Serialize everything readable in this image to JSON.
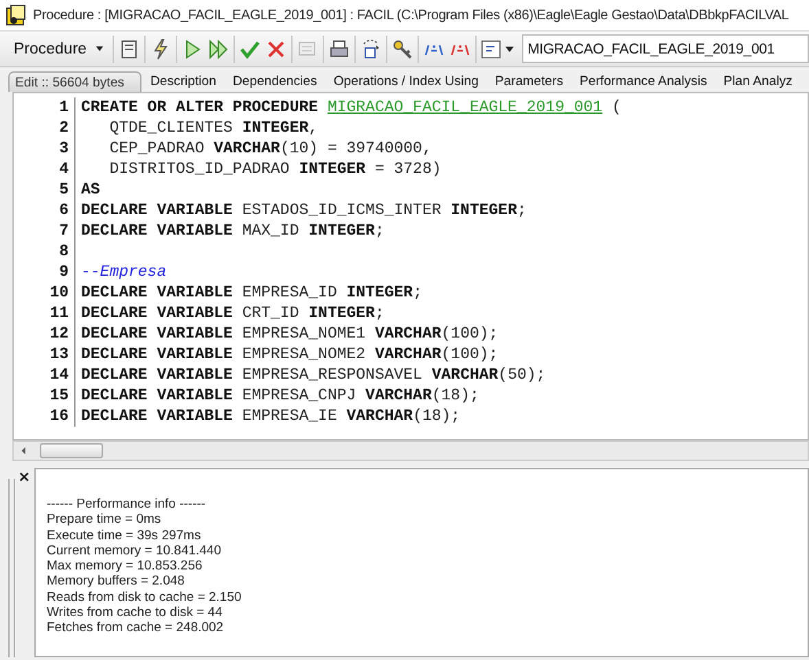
{
  "window": {
    "title": "Procedure : [MIGRACAO_FACIL_EAGLE_2019_001] : FACIL (C:\\Program Files (x86)\\Eagle\\Eagle Gestao\\Data\\DBbkpFACILVAL"
  },
  "toolbar": {
    "object_type": "Procedure",
    "object_name": "MIGRACAO_FACIL_EAGLE_2019_001"
  },
  "tabs": [
    {
      "label": "Edit :: 56604 bytes",
      "selected": true
    },
    {
      "label": "Description",
      "selected": false
    },
    {
      "label": "Dependencies",
      "selected": false
    },
    {
      "label": "Operations / Index Using",
      "selected": false
    },
    {
      "label": "Parameters",
      "selected": false
    },
    {
      "label": "Performance Analysis",
      "selected": false
    },
    {
      "label": "Plan Analyz",
      "selected": false
    }
  ],
  "editor": {
    "lines": [
      {
        "number": "1",
        "segments": [
          {
            "kind": "keyword",
            "text": "CREATE OR ALTER PROCEDURE "
          },
          {
            "kind": "name",
            "text": "MIGRACAO_FACIL_EAGLE_2019_001"
          },
          {
            "kind": "plain",
            "text": " ("
          }
        ]
      },
      {
        "number": "2",
        "segments": [
          {
            "kind": "plain",
            "text": "   QTDE_CLIENTES "
          },
          {
            "kind": "keyword",
            "text": "INTEGER"
          },
          {
            "kind": "plain",
            "text": ","
          }
        ]
      },
      {
        "number": "3",
        "segments": [
          {
            "kind": "plain",
            "text": "   CEP_PADRAO "
          },
          {
            "kind": "keyword",
            "text": "VARCHAR"
          },
          {
            "kind": "plain",
            "text": "(10) = 39740000,"
          }
        ]
      },
      {
        "number": "4",
        "segments": [
          {
            "kind": "plain",
            "text": "   DISTRITOS_ID_PADRAO "
          },
          {
            "kind": "keyword",
            "text": "INTEGER"
          },
          {
            "kind": "plain",
            "text": " = 3728)"
          }
        ]
      },
      {
        "number": "5",
        "segments": [
          {
            "kind": "keyword",
            "text": "AS"
          }
        ]
      },
      {
        "number": "6",
        "segments": [
          {
            "kind": "keyword",
            "text": "DECLARE VARIABLE "
          },
          {
            "kind": "plain",
            "text": "ESTADOS_ID_ICMS_INTER "
          },
          {
            "kind": "keyword",
            "text": "INTEGER"
          },
          {
            "kind": "plain",
            "text": ";"
          }
        ]
      },
      {
        "number": "7",
        "segments": [
          {
            "kind": "keyword",
            "text": "DECLARE VARIABLE "
          },
          {
            "kind": "plain",
            "text": "MAX_ID "
          },
          {
            "kind": "keyword",
            "text": "INTEGER"
          },
          {
            "kind": "plain",
            "text": ";"
          }
        ]
      },
      {
        "number": "8"
      },
      {
        "number": "9",
        "segments": [
          {
            "kind": "comment",
            "text": "--Empresa"
          }
        ]
      },
      {
        "number": "10",
        "segments": [
          {
            "kind": "keyword",
            "text": "DECLARE VARIABLE "
          },
          {
            "kind": "plain",
            "text": "EMPRESA_ID "
          },
          {
            "kind": "keyword",
            "text": "INTEGER"
          },
          {
            "kind": "plain",
            "text": ";"
          }
        ]
      },
      {
        "number": "11",
        "segments": [
          {
            "kind": "keyword",
            "text": "DECLARE VARIABLE "
          },
          {
            "kind": "plain",
            "text": "CRT_ID "
          },
          {
            "kind": "keyword",
            "text": "INTEGER"
          },
          {
            "kind": "plain",
            "text": ";"
          }
        ]
      },
      {
        "number": "12",
        "segments": [
          {
            "kind": "keyword",
            "text": "DECLARE VARIABLE "
          },
          {
            "kind": "plain",
            "text": "EMPRESA_NOME1 "
          },
          {
            "kind": "keyword",
            "text": "VARCHAR"
          },
          {
            "kind": "plain",
            "text": "(100);"
          }
        ]
      },
      {
        "number": "13",
        "segments": [
          {
            "kind": "keyword",
            "text": "DECLARE VARIABLE "
          },
          {
            "kind": "plain",
            "text": "EMPRESA_NOME2 "
          },
          {
            "kind": "keyword",
            "text": "VARCHAR"
          },
          {
            "kind": "plain",
            "text": "(100);"
          }
        ]
      },
      {
        "number": "14",
        "segments": [
          {
            "kind": "keyword",
            "text": "DECLARE VARIABLE "
          },
          {
            "kind": "plain",
            "text": "EMPRESA_RESPONSAVEL "
          },
          {
            "kind": "keyword",
            "text": "VARCHAR"
          },
          {
            "kind": "plain",
            "text": "(50);"
          }
        ]
      },
      {
        "number": "15",
        "segments": [
          {
            "kind": "keyword",
            "text": "DECLARE VARIABLE "
          },
          {
            "kind": "plain",
            "text": "EMPRESA_CNPJ "
          },
          {
            "kind": "keyword",
            "text": "VARCHAR"
          },
          {
            "kind": "plain",
            "text": "(18);"
          }
        ]
      },
      {
        "number": "16",
        "segments": [
          {
            "kind": "keyword",
            "text": "DECLARE VARIABLE "
          },
          {
            "kind": "plain",
            "text": "EMPRESA_IE "
          },
          {
            "kind": "keyword",
            "text": "VARCHAR"
          },
          {
            "kind": "plain",
            "text": "(18);"
          }
        ]
      }
    ]
  },
  "output": {
    "close": "×",
    "lines": [
      "------ Performance info ------",
      "Prepare time = 0ms",
      "Execute time = 39s 297ms",
      "Current memory = 10.841.440",
      "Max memory = 10.853.256",
      "Memory buffers = 2.048",
      "Reads from disk to cache = 2.150",
      "Writes from cache to disk = 44",
      "Fetches from cache = 248.002"
    ]
  }
}
